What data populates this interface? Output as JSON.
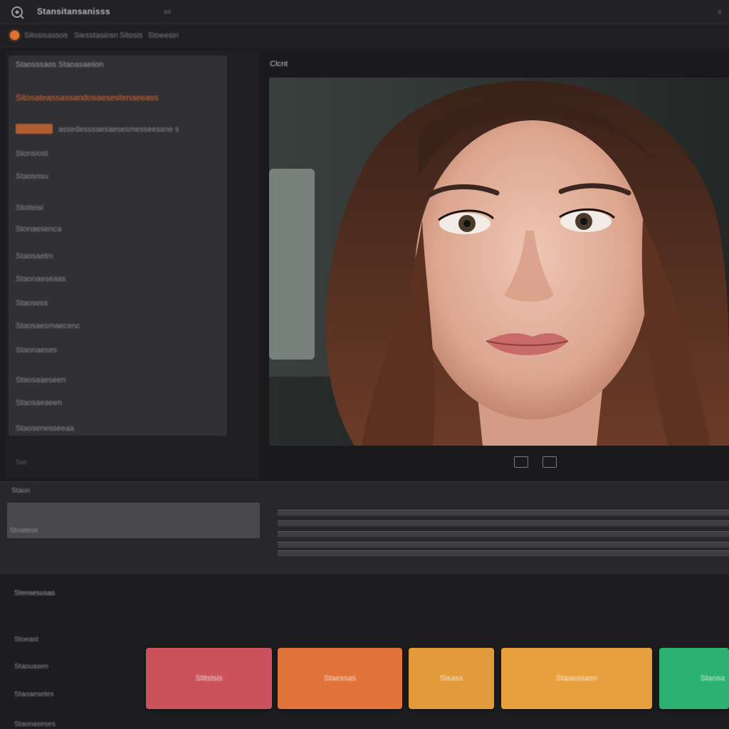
{
  "titlebar": {
    "app_title": "Stansitansanisss",
    "extra": "aa",
    "extra_right": "a"
  },
  "menu": {
    "items": [
      "Sitosisassos",
      "Siesstasiosn",
      "Sitosis",
      "Stoeesin"
    ]
  },
  "left_panel": {
    "header": "Staosssaos Staoasaeiion",
    "accent_line": "Sitosateassassandosaesestenaeeass",
    "accent_row_text": "assedesssaesaesesmesseessne s",
    "items": [
      "Stonsiost",
      "Staosnsu",
      "Stoiteisi",
      "Stonaesenca",
      "Staosaetm",
      "Staonaeseaas",
      "Staosess",
      "Staosaesmaecenc",
      "Staonaeses",
      "Staosaaeseen",
      "Staosaeaeen",
      "Staosenesseeaa"
    ],
    "footer": "Sas"
  },
  "viewer": {
    "title": "Clcnt"
  },
  "middle": {
    "label_top": "Staon",
    "label_mid": "Stoatese"
  },
  "bottom": {
    "header": "Stensesusas",
    "labels": [
      "Stoeast",
      "Staouasen",
      "Staoaesetes",
      "Staonaseses"
    ]
  },
  "status_buttons": [
    {
      "label": "Stitstsis",
      "color": "#c9525c"
    },
    {
      "label": "Staessas",
      "color": "#df7339"
    },
    {
      "label": "Sisass",
      "color": "#e39a3b"
    },
    {
      "label": "Staaessasn",
      "color": "#e8a03e"
    },
    {
      "label": "Stansa",
      "color": "#2bb172"
    }
  ]
}
